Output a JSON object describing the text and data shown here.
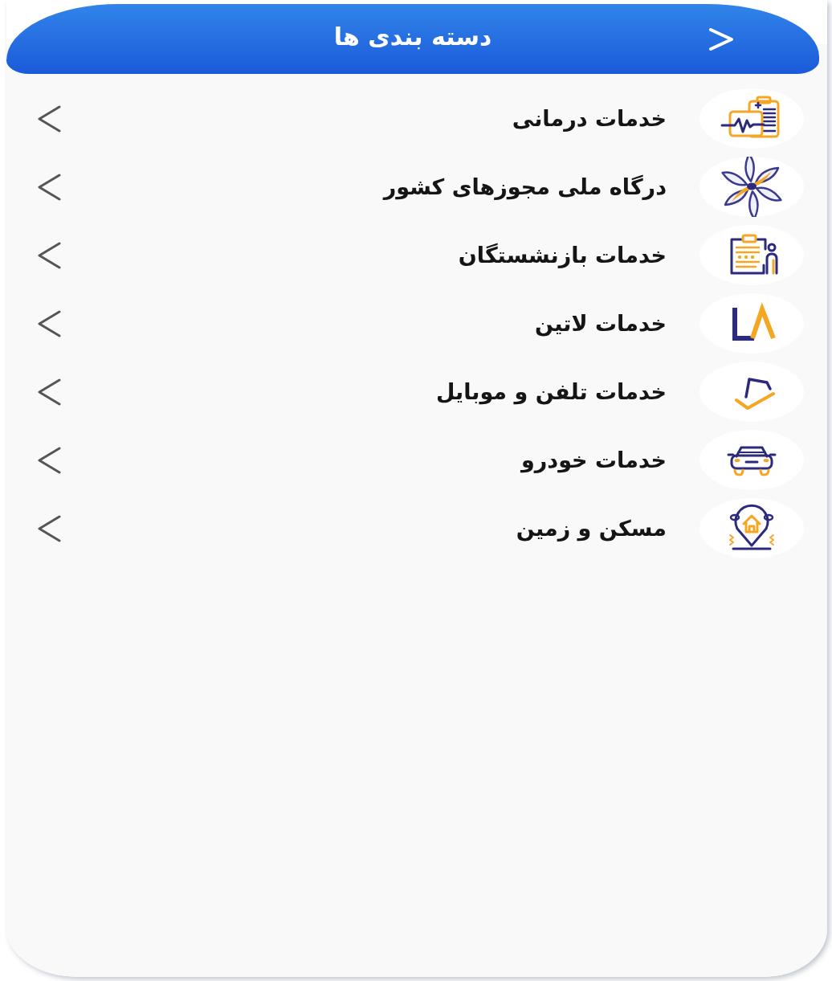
{
  "header": {
    "title": "دسته بندی ها"
  },
  "categories": [
    {
      "label": "خدمات درمانی",
      "kind": "medical"
    },
    {
      "label": "درگاه ملی مجوزهای کشور",
      "kind": "portal"
    },
    {
      "label": "خدمات بازنشستگان",
      "kind": "pension"
    },
    {
      "label": "خدمات لاتین",
      "kind": "latin"
    },
    {
      "label": "خدمات تلفن و موبایل",
      "kind": "phone"
    },
    {
      "label": "خدمات خودرو",
      "kind": "car"
    },
    {
      "label": "مسکن و زمین",
      "kind": "housing"
    }
  ]
}
